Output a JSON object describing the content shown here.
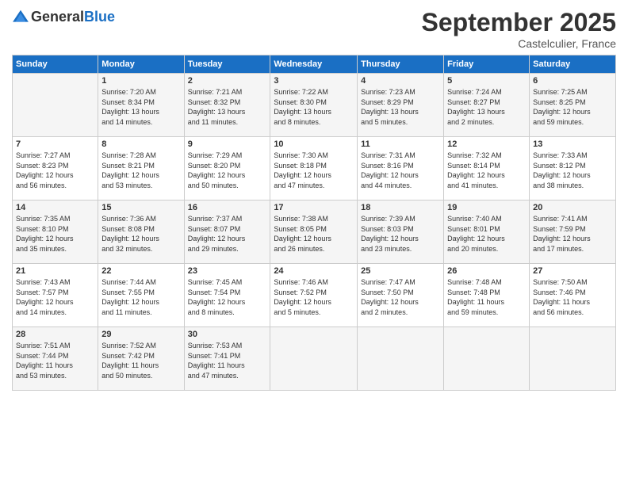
{
  "logo": {
    "general": "General",
    "blue": "Blue"
  },
  "title": "September 2025",
  "subtitle": "Castelculier, France",
  "days_of_week": [
    "Sunday",
    "Monday",
    "Tuesday",
    "Wednesday",
    "Thursday",
    "Friday",
    "Saturday"
  ],
  "weeks": [
    [
      {
        "day": "",
        "info": ""
      },
      {
        "day": "1",
        "info": "Sunrise: 7:20 AM\nSunset: 8:34 PM\nDaylight: 13 hours\nand 14 minutes."
      },
      {
        "day": "2",
        "info": "Sunrise: 7:21 AM\nSunset: 8:32 PM\nDaylight: 13 hours\nand 11 minutes."
      },
      {
        "day": "3",
        "info": "Sunrise: 7:22 AM\nSunset: 8:30 PM\nDaylight: 13 hours\nand 8 minutes."
      },
      {
        "day": "4",
        "info": "Sunrise: 7:23 AM\nSunset: 8:29 PM\nDaylight: 13 hours\nand 5 minutes."
      },
      {
        "day": "5",
        "info": "Sunrise: 7:24 AM\nSunset: 8:27 PM\nDaylight: 13 hours\nand 2 minutes."
      },
      {
        "day": "6",
        "info": "Sunrise: 7:25 AM\nSunset: 8:25 PM\nDaylight: 12 hours\nand 59 minutes."
      }
    ],
    [
      {
        "day": "7",
        "info": "Sunrise: 7:27 AM\nSunset: 8:23 PM\nDaylight: 12 hours\nand 56 minutes."
      },
      {
        "day": "8",
        "info": "Sunrise: 7:28 AM\nSunset: 8:21 PM\nDaylight: 12 hours\nand 53 minutes."
      },
      {
        "day": "9",
        "info": "Sunrise: 7:29 AM\nSunset: 8:20 PM\nDaylight: 12 hours\nand 50 minutes."
      },
      {
        "day": "10",
        "info": "Sunrise: 7:30 AM\nSunset: 8:18 PM\nDaylight: 12 hours\nand 47 minutes."
      },
      {
        "day": "11",
        "info": "Sunrise: 7:31 AM\nSunset: 8:16 PM\nDaylight: 12 hours\nand 44 minutes."
      },
      {
        "day": "12",
        "info": "Sunrise: 7:32 AM\nSunset: 8:14 PM\nDaylight: 12 hours\nand 41 minutes."
      },
      {
        "day": "13",
        "info": "Sunrise: 7:33 AM\nSunset: 8:12 PM\nDaylight: 12 hours\nand 38 minutes."
      }
    ],
    [
      {
        "day": "14",
        "info": "Sunrise: 7:35 AM\nSunset: 8:10 PM\nDaylight: 12 hours\nand 35 minutes."
      },
      {
        "day": "15",
        "info": "Sunrise: 7:36 AM\nSunset: 8:08 PM\nDaylight: 12 hours\nand 32 minutes."
      },
      {
        "day": "16",
        "info": "Sunrise: 7:37 AM\nSunset: 8:07 PM\nDaylight: 12 hours\nand 29 minutes."
      },
      {
        "day": "17",
        "info": "Sunrise: 7:38 AM\nSunset: 8:05 PM\nDaylight: 12 hours\nand 26 minutes."
      },
      {
        "day": "18",
        "info": "Sunrise: 7:39 AM\nSunset: 8:03 PM\nDaylight: 12 hours\nand 23 minutes."
      },
      {
        "day": "19",
        "info": "Sunrise: 7:40 AM\nSunset: 8:01 PM\nDaylight: 12 hours\nand 20 minutes."
      },
      {
        "day": "20",
        "info": "Sunrise: 7:41 AM\nSunset: 7:59 PM\nDaylight: 12 hours\nand 17 minutes."
      }
    ],
    [
      {
        "day": "21",
        "info": "Sunrise: 7:43 AM\nSunset: 7:57 PM\nDaylight: 12 hours\nand 14 minutes."
      },
      {
        "day": "22",
        "info": "Sunrise: 7:44 AM\nSunset: 7:55 PM\nDaylight: 12 hours\nand 11 minutes."
      },
      {
        "day": "23",
        "info": "Sunrise: 7:45 AM\nSunset: 7:54 PM\nDaylight: 12 hours\nand 8 minutes."
      },
      {
        "day": "24",
        "info": "Sunrise: 7:46 AM\nSunset: 7:52 PM\nDaylight: 12 hours\nand 5 minutes."
      },
      {
        "day": "25",
        "info": "Sunrise: 7:47 AM\nSunset: 7:50 PM\nDaylight: 12 hours\nand 2 minutes."
      },
      {
        "day": "26",
        "info": "Sunrise: 7:48 AM\nSunset: 7:48 PM\nDaylight: 11 hours\nand 59 minutes."
      },
      {
        "day": "27",
        "info": "Sunrise: 7:50 AM\nSunset: 7:46 PM\nDaylight: 11 hours\nand 56 minutes."
      }
    ],
    [
      {
        "day": "28",
        "info": "Sunrise: 7:51 AM\nSunset: 7:44 PM\nDaylight: 11 hours\nand 53 minutes."
      },
      {
        "day": "29",
        "info": "Sunrise: 7:52 AM\nSunset: 7:42 PM\nDaylight: 11 hours\nand 50 minutes."
      },
      {
        "day": "30",
        "info": "Sunrise: 7:53 AM\nSunset: 7:41 PM\nDaylight: 11 hours\nand 47 minutes."
      },
      {
        "day": "",
        "info": ""
      },
      {
        "day": "",
        "info": ""
      },
      {
        "day": "",
        "info": ""
      },
      {
        "day": "",
        "info": ""
      }
    ]
  ]
}
